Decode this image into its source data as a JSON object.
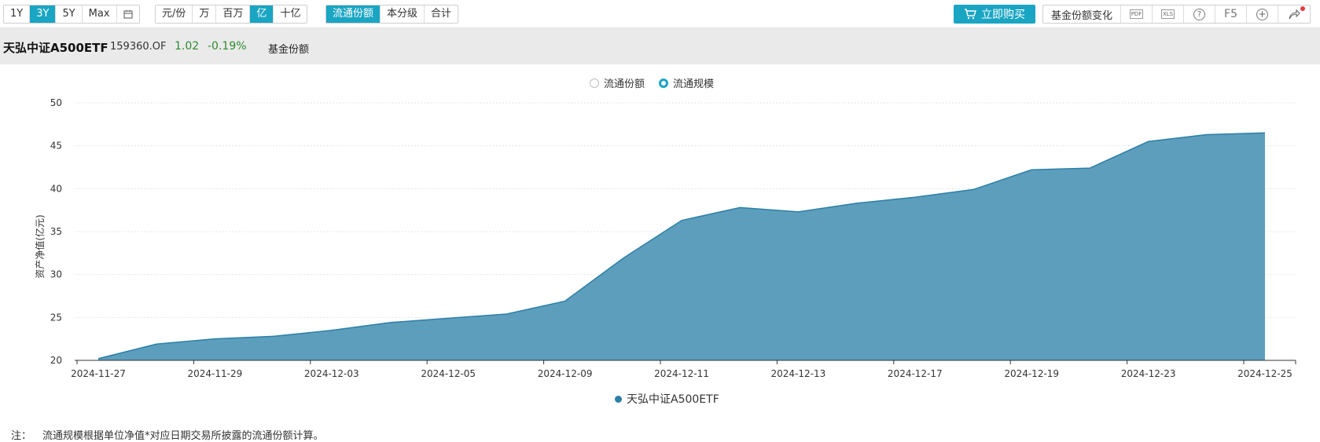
{
  "toolbar": {
    "periods": [
      "1Y",
      "3Y",
      "5Y",
      "Max"
    ],
    "period_active": "3Y",
    "units": [
      "元/份",
      "万",
      "百万",
      "亿",
      "十亿"
    ],
    "unit_active": "亿",
    "views": [
      "流通份额",
      "本分级",
      "合计"
    ],
    "view_active": "流通份额",
    "buy_label": "立即购买",
    "change_label": "基金份额变化",
    "pdf_label": "PDF",
    "xls_label": "XLS",
    "help_label": "?",
    "f5_label": "F5",
    "plus_label": "+"
  },
  "title": {
    "name": "天弘中证A500ETF",
    "code": "159360.OF",
    "nav": "1.02",
    "change": "-0.19%",
    "sub": "基金份额"
  },
  "radios": {
    "share": "流通份额",
    "scale": "流通规模",
    "selected": "流通规模"
  },
  "note": {
    "label": "注：",
    "text": "流通规模根据单位净值*对应日期交易所披露的流通份额计算。"
  },
  "colors": {
    "accent": "#1aa5c3",
    "area_fill": "#5e9ebd",
    "area_line": "#2b7fa6",
    "up_down": "#2e8b2e"
  },
  "chart_data": {
    "type": "area",
    "ylabel": "资产净值(亿元)",
    "ylim": [
      20,
      50
    ],
    "yticks": [
      20,
      25,
      30,
      35,
      40,
      45,
      50
    ],
    "xtick_labels": [
      "2024-11-27",
      "2024-11-29",
      "2024-12-03",
      "2024-12-05",
      "2024-12-09",
      "2024-12-11",
      "2024-12-13",
      "2024-12-17",
      "2024-12-19",
      "2024-12-23",
      "2024-12-25"
    ],
    "x": [
      "2024-11-27",
      "2024-11-28",
      "2024-11-29",
      "2024-12-02",
      "2024-12-03",
      "2024-12-04",
      "2024-12-05",
      "2024-12-06",
      "2024-12-09",
      "2024-12-10",
      "2024-12-11",
      "2024-12-12",
      "2024-12-13",
      "2024-12-16",
      "2024-12-17",
      "2024-12-18",
      "2024-12-19",
      "2024-12-20",
      "2024-12-23",
      "2024-12-24",
      "2024-12-25"
    ],
    "series": [
      {
        "name": "天弘中证A500ETF",
        "values": [
          20.2,
          21.9,
          22.5,
          22.8,
          23.5,
          24.4,
          24.9,
          25.4,
          26.9,
          31.9,
          36.3,
          37.8,
          37.3,
          38.3,
          39.0,
          39.9,
          42.2,
          42.4,
          45.5,
          46.3,
          46.5
        ]
      }
    ],
    "grid": true
  }
}
